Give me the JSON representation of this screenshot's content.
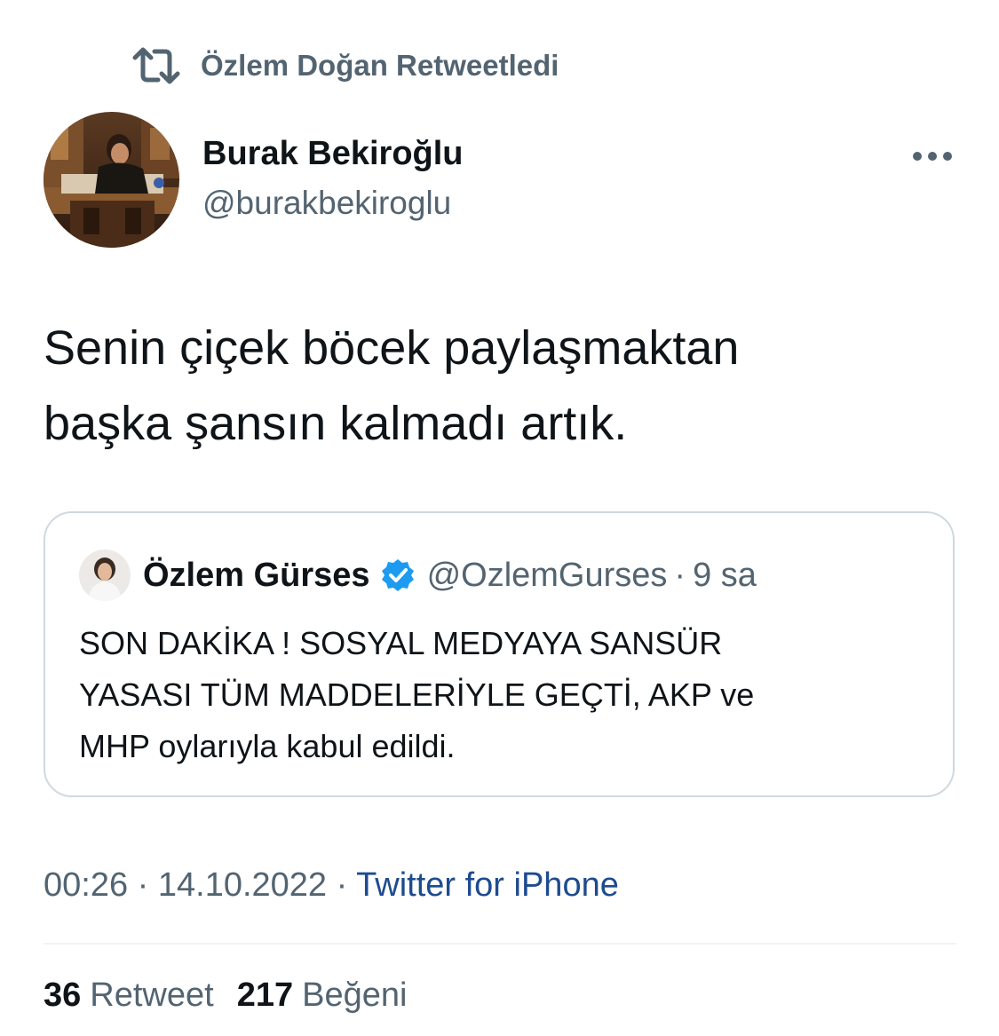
{
  "retweet_context": {
    "icon": "retweet-icon",
    "text": "Özlem Doğan Retweetledi"
  },
  "tweet": {
    "author": {
      "display_name": "Burak Bekiroğlu",
      "handle": "@burakbekiroglu"
    },
    "more_icon": "more-horizontal-icon",
    "text_lines": [
      "Senin çiçek böcek paylaşmaktan",
      "başka şansın kalmadı artık."
    ]
  },
  "quote": {
    "author": {
      "display_name": "Özlem Gürses",
      "verified_icon": "verified-badge-icon",
      "handle": "@OzlemGurses",
      "separator": "·",
      "time": "9 sa"
    },
    "text_lines": [
      "SON DAKİKA ! SOSYAL MEDYAYA SANSÜR",
      "YASASI TÜM MADDELERİYLE GEÇTİ, AKP ve",
      "MHP oylarıyla kabul edildi."
    ]
  },
  "meta": {
    "time": "00:26",
    "separator": "·",
    "date": "14.10.2022",
    "source": "Twitter for iPhone"
  },
  "stats": {
    "retweets": {
      "count": "36",
      "label": "Retweet"
    },
    "likes": {
      "count": "217",
      "label": "Beğeni"
    }
  },
  "colors": {
    "text_primary": "#0f1419",
    "text_secondary": "#536471",
    "verified": "#1d9bf0",
    "source_link": "#1d4b8f",
    "border": "#cfd9de"
  }
}
